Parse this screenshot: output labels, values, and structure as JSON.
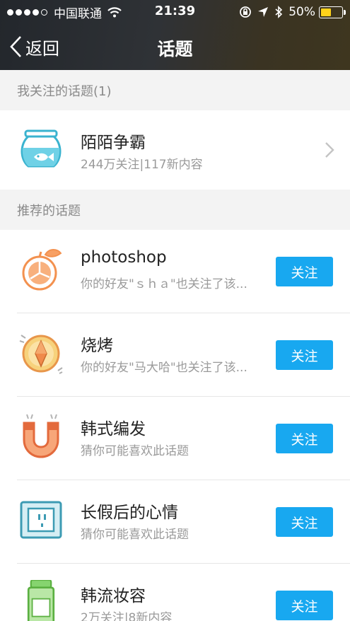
{
  "status_bar": {
    "carrier": "中国联通",
    "time": "21:39",
    "battery": "50%",
    "battery_level": 0.5
  },
  "nav": {
    "back_label": "返回",
    "title": "话题"
  },
  "followed_section": {
    "header": "我关注的话题(1)",
    "items": [
      {
        "title": "陌陌争霸",
        "subtitle": "244万关注|117新内容",
        "icon": "fishbowl-icon"
      }
    ]
  },
  "recommended_section": {
    "header": "推荐的话题",
    "follow_label": "关注",
    "items": [
      {
        "title": "photoshop",
        "subtitle": "你的好友\"ｓｈａ\"也关注了该...",
        "icon": "orange-icon"
      },
      {
        "title": "烧烤",
        "subtitle": "你的好友\"马大哈\"也关注了该...",
        "icon": "compass-icon"
      },
      {
        "title": "韩式编发",
        "subtitle": "猜你可能喜欢此话题",
        "icon": "magnet-icon"
      },
      {
        "title": "长假后的心情",
        "subtitle": "猜你可能喜欢此话题",
        "icon": "socket-icon"
      },
      {
        "title": "韩流妆容",
        "subtitle": "2万关注|8新内容",
        "icon": "bottle-icon"
      }
    ]
  }
}
